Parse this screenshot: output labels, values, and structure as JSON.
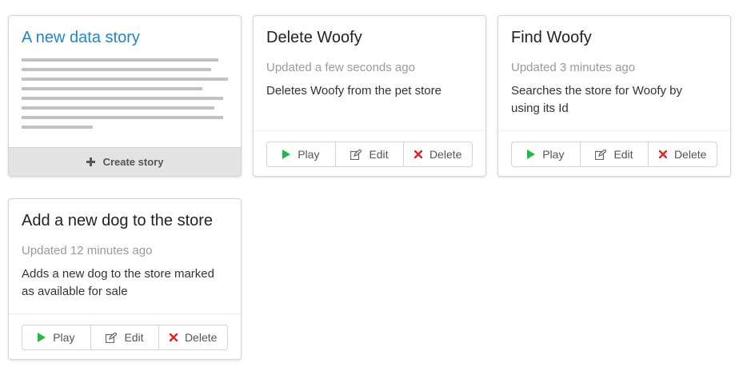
{
  "new_story": {
    "title": "A new data story",
    "create_label": "Create story",
    "plus_icon": "plus-icon",
    "lines": 7
  },
  "actions": {
    "play_label": "Play",
    "edit_label": "Edit",
    "delete_label": "Delete",
    "play_color": "#21ba45",
    "delete_color": "#db2828"
  },
  "stories": [
    {
      "title": "Delete Woofy",
      "updated": "Updated a few seconds ago",
      "description": "Deletes Woofy from the pet store"
    },
    {
      "title": "Find Woofy",
      "updated": "Updated 3 minutes ago",
      "description": "Searches the store for Woofy by using its Id"
    },
    {
      "title": "Add a new dog to the store",
      "updated": "Updated 12 minutes ago",
      "description": "Adds a new dog to the store marked as available for sale"
    }
  ]
}
